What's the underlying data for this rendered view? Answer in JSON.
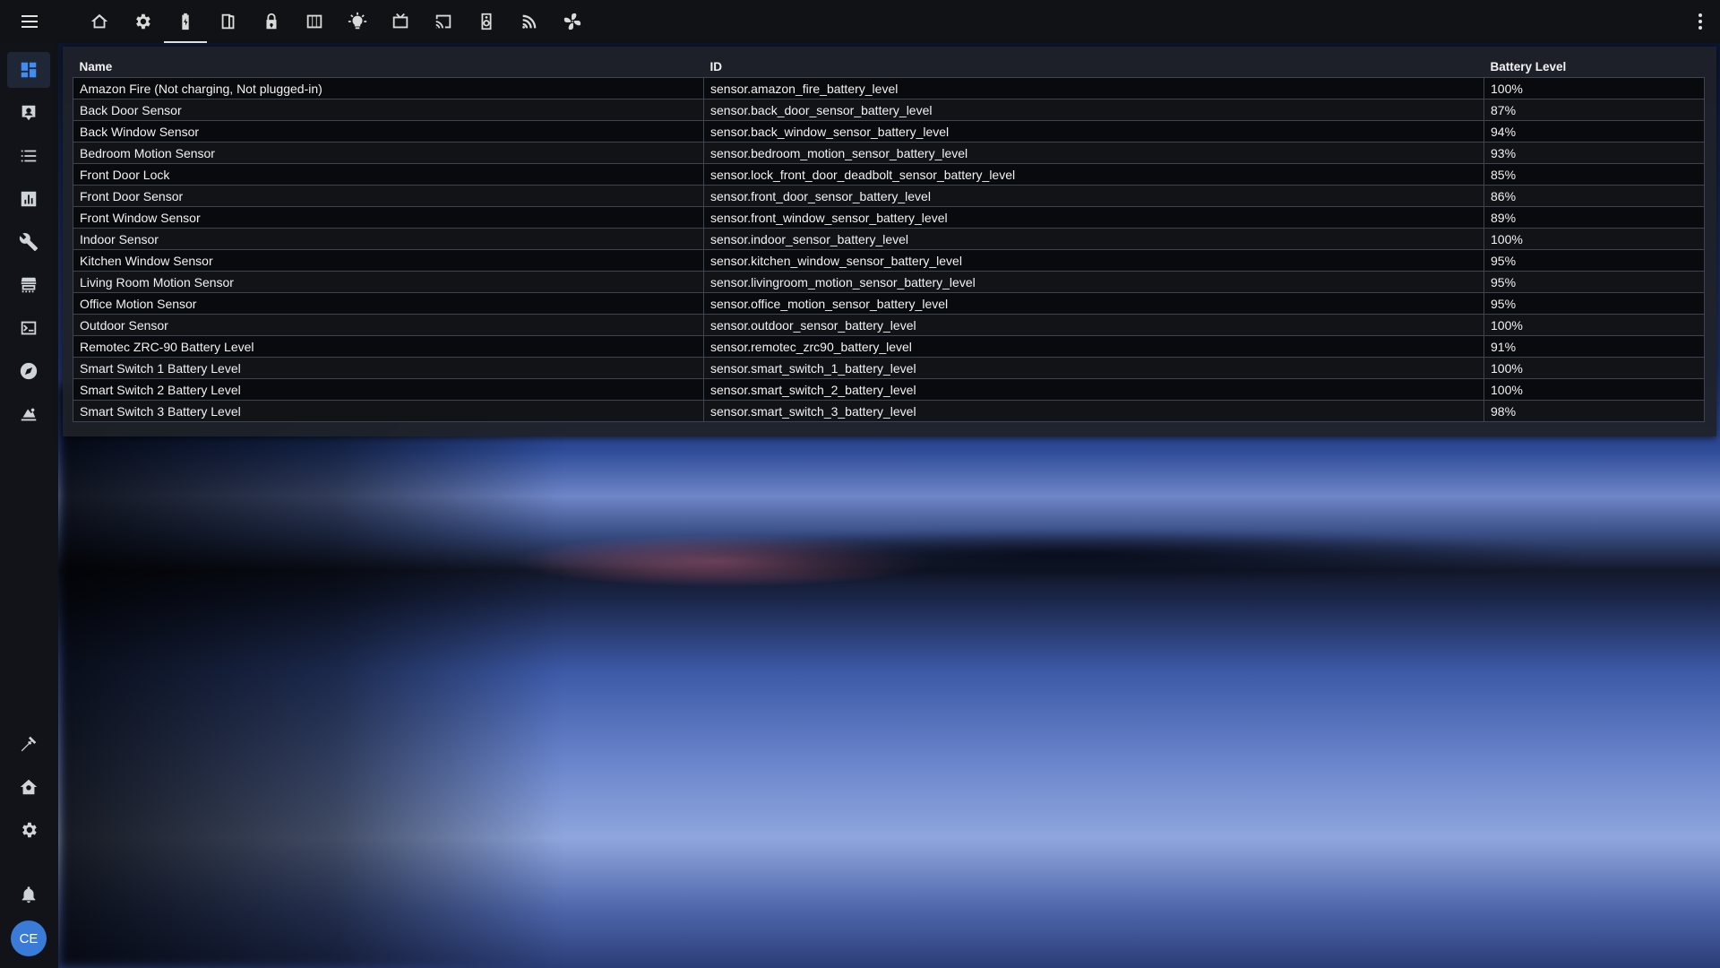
{
  "topbar": {
    "tabs": [
      {
        "icon": "home-outline-icon",
        "active": false
      },
      {
        "icon": "gear-icon",
        "active": false
      },
      {
        "icon": "battery-charging-icon",
        "active": true
      },
      {
        "icon": "door-open-icon",
        "active": false
      },
      {
        "icon": "lock-icon",
        "active": false
      },
      {
        "icon": "window-blinds-icon",
        "active": false
      },
      {
        "icon": "lightbulb-icon",
        "active": false
      },
      {
        "icon": "television-icon",
        "active": false
      },
      {
        "icon": "cast-icon",
        "active": false
      },
      {
        "icon": "speaker-icon",
        "active": false
      },
      {
        "icon": "wifi-signal-icon",
        "active": false
      },
      {
        "icon": "fan-icon",
        "active": false
      }
    ]
  },
  "sidebar": {
    "items": [
      {
        "icon": "dashboard-icon",
        "selected": true
      },
      {
        "icon": "map-icon",
        "selected": false
      },
      {
        "icon": "logbook-icon",
        "selected": false
      },
      {
        "icon": "history-chart-icon",
        "selected": false
      },
      {
        "icon": "wrench-icon",
        "selected": false
      },
      {
        "icon": "hacs-store-icon",
        "selected": false
      },
      {
        "icon": "terminal-icon",
        "selected": false
      },
      {
        "icon": "compass-icon",
        "selected": false
      },
      {
        "icon": "media-browser-icon",
        "selected": false
      },
      {
        "icon": "hammer-icon",
        "selected": false
      },
      {
        "icon": "supervisor-home-icon",
        "selected": false
      },
      {
        "icon": "settings-cog-icon",
        "selected": false
      },
      {
        "icon": "bell-icon",
        "selected": false
      }
    ],
    "avatar_initials": "CE"
  },
  "table": {
    "headers": [
      "Name",
      "ID",
      "Battery Level"
    ],
    "rows": [
      [
        "Amazon Fire (Not charging, Not plugged-in)",
        "sensor.amazon_fire_battery_level",
        "100%"
      ],
      [
        "Back Door Sensor",
        "sensor.back_door_sensor_battery_level",
        "87%"
      ],
      [
        "Back Window Sensor",
        "sensor.back_window_sensor_battery_level",
        "94%"
      ],
      [
        "Bedroom Motion Sensor",
        "sensor.bedroom_motion_sensor_battery_level",
        "93%"
      ],
      [
        "Front Door Lock",
        "sensor.lock_front_door_deadbolt_sensor_battery_level",
        "85%"
      ],
      [
        "Front Door Sensor",
        "sensor.front_door_sensor_battery_level",
        "86%"
      ],
      [
        "Front Window Sensor",
        "sensor.front_window_sensor_battery_level",
        "89%"
      ],
      [
        "Indoor Sensor",
        "sensor.indoor_sensor_battery_level",
        "100%"
      ],
      [
        "Kitchen Window Sensor",
        "sensor.kitchen_window_sensor_battery_level",
        "95%"
      ],
      [
        "Living Room Motion Sensor",
        "sensor.livingroom_motion_sensor_battery_level",
        "95%"
      ],
      [
        "Office Motion Sensor",
        "sensor.office_motion_sensor_battery_level",
        "95%"
      ],
      [
        "Outdoor Sensor",
        "sensor.outdoor_sensor_battery_level",
        "100%"
      ],
      [
        "Remotec ZRC-90 Battery Level",
        "sensor.remotec_zrc90_battery_level",
        "91%"
      ],
      [
        "Smart Switch 1 Battery Level",
        "sensor.smart_switch_1_battery_level",
        "100%"
      ],
      [
        "Smart Switch 2 Battery Level",
        "sensor.smart_switch_2_battery_level",
        "100%"
      ],
      [
        "Smart Switch 3 Battery Level",
        "sensor.smart_switch_3_battery_level",
        "98%"
      ]
    ]
  },
  "colors": {
    "accent": "#3f8cf3",
    "topbar": "#101215",
    "sidebar": "#111318",
    "avatar": "#3b7bd8"
  }
}
